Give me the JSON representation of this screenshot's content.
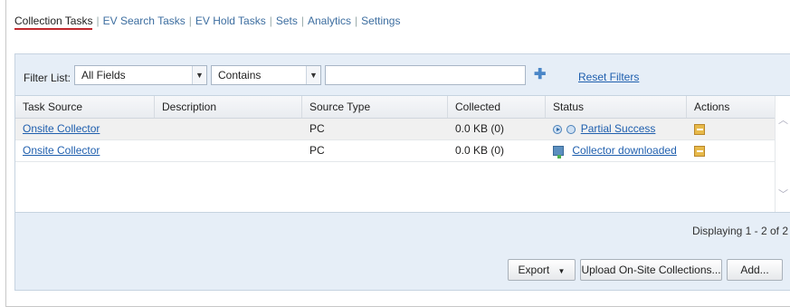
{
  "tabs": [
    {
      "label": "Collection Tasks",
      "active": true
    },
    {
      "label": "EV Search Tasks"
    },
    {
      "label": "EV Hold Tasks"
    },
    {
      "label": "Sets"
    },
    {
      "label": "Analytics"
    },
    {
      "label": "Settings"
    }
  ],
  "filter": {
    "label": "Filter List:",
    "field_value": "All Fields",
    "operator_value": "Contains",
    "text_value": "",
    "reset_label": "Reset Filters"
  },
  "columns": [
    "Task Source",
    "Description",
    "Source Type",
    "Collected",
    "Status",
    "Actions"
  ],
  "rows": [
    {
      "task_source": "Onsite Collector",
      "description": "",
      "source_type": "PC",
      "collected": "0.0 KB (0)",
      "status": "Partial Success"
    },
    {
      "task_source": "Onsite Collector",
      "description": "",
      "source_type": "PC",
      "collected": "0.0 KB (0)",
      "status": "Collector downloaded"
    }
  ],
  "pager": "Displaying 1 - 2 of 2",
  "buttons": {
    "export": "Export",
    "upload": "Upload On-Site Collections...",
    "add": "Add..."
  },
  "icons": {
    "status_1": [
      "info-circle-icon",
      "clock-circle-icon"
    ],
    "status_2": "download-computer-icon",
    "action": "edit-icon"
  }
}
